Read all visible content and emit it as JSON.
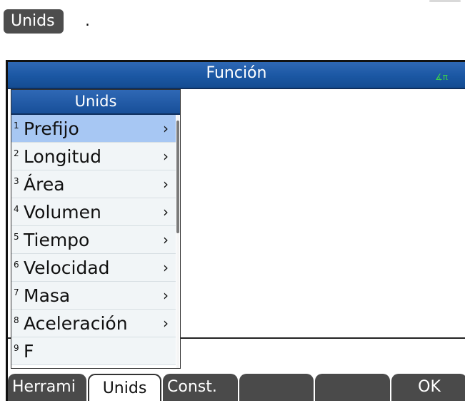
{
  "top": {
    "units_chip": "Unids",
    "period": "."
  },
  "window": {
    "title": "Función",
    "angle_mode": "∡π"
  },
  "menu": {
    "title": "Unids",
    "items": [
      {
        "num": "1",
        "label": "Prefijo",
        "arrow": "›"
      },
      {
        "num": "2",
        "label": "Longitud",
        "arrow": "›"
      },
      {
        "num": "3",
        "label": "Área",
        "arrow": "›"
      },
      {
        "num": "4",
        "label": "Volumen",
        "arrow": "›"
      },
      {
        "num": "5",
        "label": "Tiempo",
        "arrow": "›"
      },
      {
        "num": "6",
        "label": "Velocidad",
        "arrow": "›"
      },
      {
        "num": "7",
        "label": "Masa",
        "arrow": "›"
      },
      {
        "num": "8",
        "label": "Aceleración",
        "arrow": "›"
      },
      {
        "num": "9",
        "label": "F",
        "arrow": ""
      }
    ]
  },
  "softkeys": [
    {
      "label": "Herrami"
    },
    {
      "label": "Unids"
    },
    {
      "label": "Const."
    },
    {
      "label": ""
    },
    {
      "label": ""
    },
    {
      "label": "OK"
    }
  ],
  "colors": {
    "title_bar": "#1b57a3",
    "selected": "#a7c7f3",
    "softkey": "#4a4a4a",
    "angle_indicator": "#3bd34b"
  }
}
